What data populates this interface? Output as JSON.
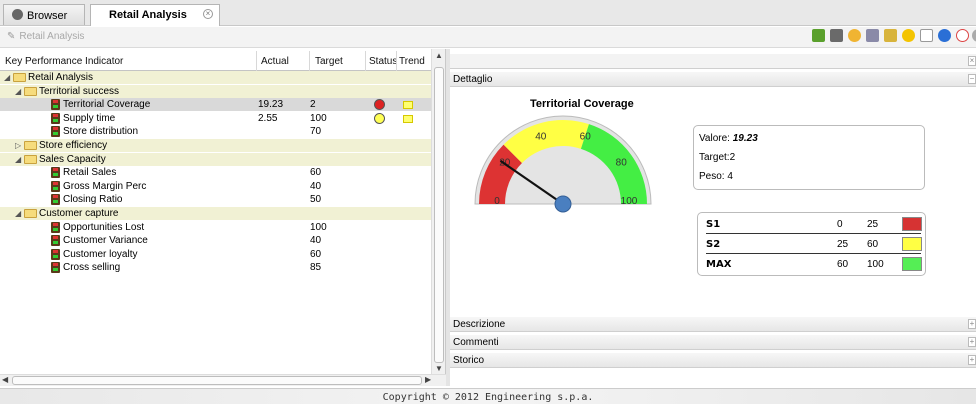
{
  "tabs": [
    {
      "label": "Browser",
      "active": false
    },
    {
      "label": "Retail Analysis",
      "active": true
    }
  ],
  "breadcrumb": "Retail Analysis",
  "toolbar_icons": [
    "refresh-icon",
    "parameters-icon",
    "hand-icon",
    "print-icon",
    "export-icon",
    "favorite-icon",
    "document-icon",
    "info-icon",
    "help-icon",
    "more-icon"
  ],
  "table": {
    "headers": {
      "kpi": "Key Performance Indicator",
      "actual": "Actual",
      "target": "Target",
      "status": "Status",
      "trend": "Trend"
    },
    "rows": [
      {
        "label": "Retail Analysis",
        "level": 0,
        "type": "group",
        "actual": "",
        "target": ""
      },
      {
        "label": "Territorial success",
        "level": 1,
        "type": "group",
        "actual": "",
        "target": ""
      },
      {
        "label": "Territorial Coverage",
        "level": 2,
        "type": "kpi",
        "actual": "19.23",
        "target": "2",
        "status": "#dd2222",
        "trend": true,
        "selected": true
      },
      {
        "label": "Supply time",
        "level": 2,
        "type": "kpi",
        "actual": "2.55",
        "target": "100",
        "status": "#ffff55",
        "trend": true
      },
      {
        "label": "Store distribution",
        "level": 2,
        "type": "kpi",
        "actual": "",
        "target": "70"
      },
      {
        "label": "Store efficiency",
        "level": 1,
        "type": "group",
        "collapsed": true,
        "actual": "",
        "target": ""
      },
      {
        "label": "Sales Capacity",
        "level": 1,
        "type": "group",
        "actual": "",
        "target": ""
      },
      {
        "label": "Retail Sales",
        "level": 2,
        "type": "kpi",
        "actual": "",
        "target": "60"
      },
      {
        "label": "Gross Margin Perc",
        "level": 2,
        "type": "kpi",
        "actual": "",
        "target": "40"
      },
      {
        "label": "Closing Ratio",
        "level": 2,
        "type": "kpi",
        "actual": "",
        "target": "50"
      },
      {
        "label": "Customer capture",
        "level": 1,
        "type": "group",
        "actual": "",
        "target": ""
      },
      {
        "label": "Opportunities Lost",
        "level": 2,
        "type": "kpi",
        "actual": "",
        "target": "100"
      },
      {
        "label": "Customer Variance",
        "level": 2,
        "type": "kpi",
        "actual": "",
        "target": "40"
      },
      {
        "label": "Customer loyalty",
        "level": 2,
        "type": "kpi",
        "actual": "",
        "target": "60"
      },
      {
        "label": "Cross selling",
        "level": 2,
        "type": "kpi",
        "actual": "",
        "target": "85"
      }
    ]
  },
  "panels": {
    "dettaglio": "Dettaglio",
    "descrizione": "Descrizione",
    "commenti": "Commenti",
    "storico": "Storico"
  },
  "gauge": {
    "title": "Territorial Coverage",
    "min": 0,
    "max": 100,
    "value": 19.23,
    "ticks": [
      "0",
      "20",
      "40",
      "60",
      "80",
      "100"
    ],
    "bands": [
      {
        "from": 0,
        "to": 25,
        "color": "#dd3333"
      },
      {
        "from": 25,
        "to": 60,
        "color": "#ffff44"
      },
      {
        "from": 60,
        "to": 100,
        "color": "#44ee44"
      }
    ]
  },
  "info": {
    "valore_label": "Valore:",
    "valore": "19.23",
    "target_label": "Target:",
    "target": "2",
    "peso_label": "Peso:",
    "peso": "4"
  },
  "legend": [
    {
      "name": "S1",
      "from": "0",
      "to": "25",
      "color": "#d63333"
    },
    {
      "name": "S2",
      "from": "25",
      "to": "60",
      "color": "#ffff44"
    },
    {
      "name": "MAX",
      "from": "60",
      "to": "100",
      "color": "#55ee55"
    }
  ],
  "footer": "Copyright © 2012 Engineering s.p.a."
}
